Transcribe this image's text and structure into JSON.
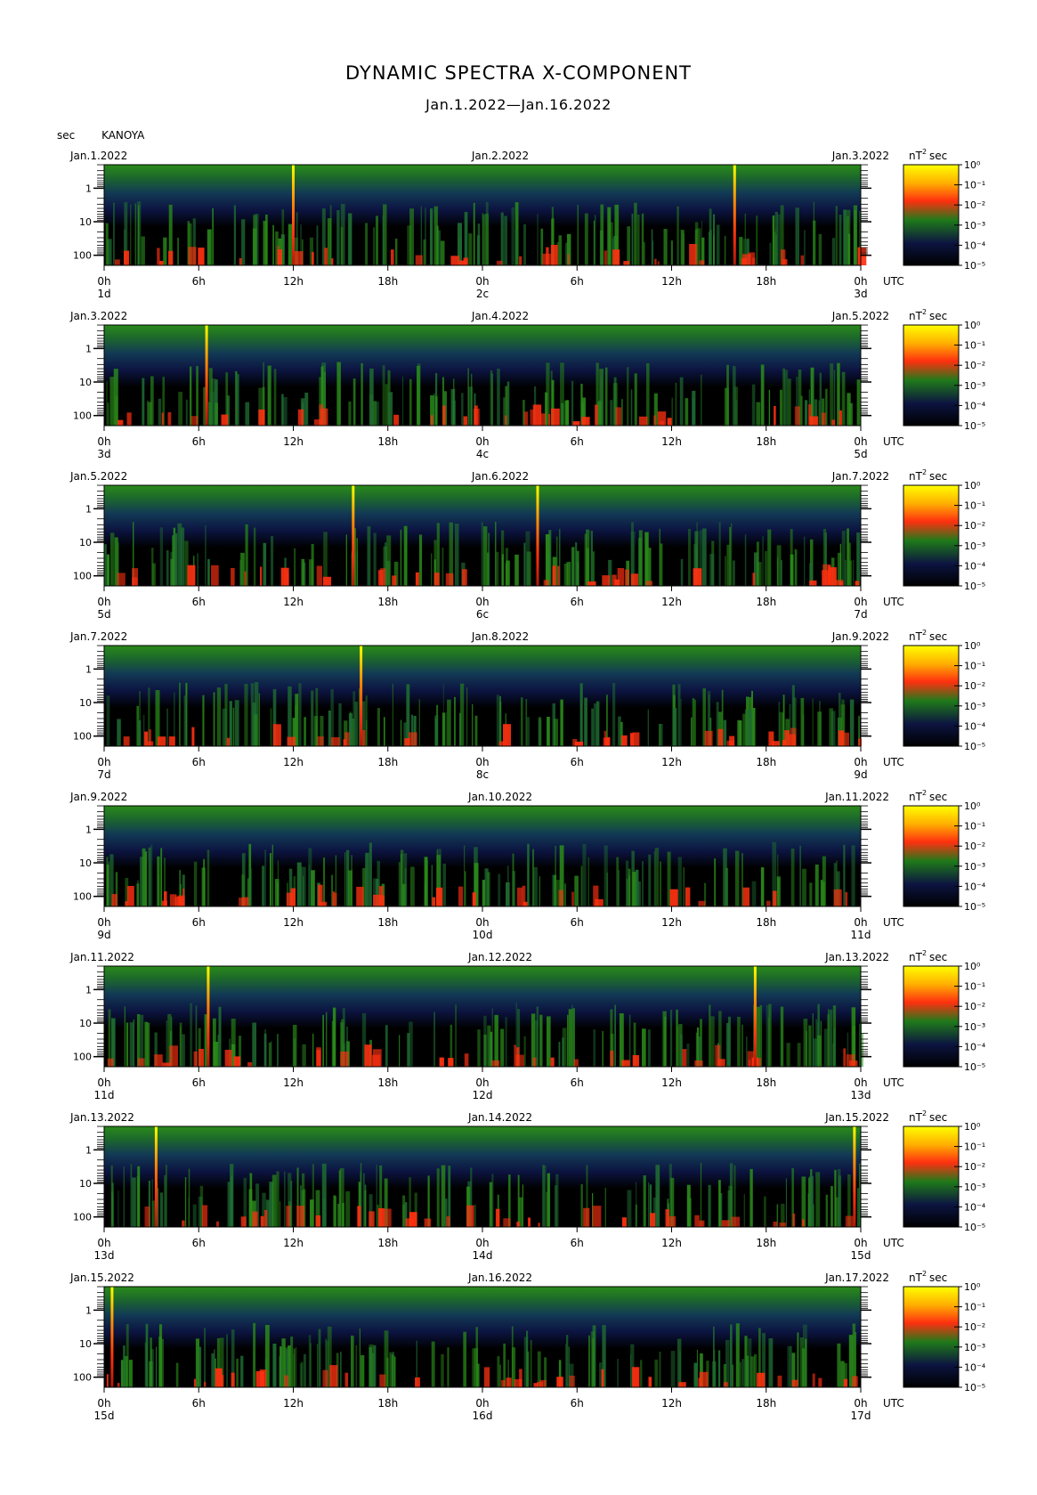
{
  "title": "DYNAMIC SPECTRA X-COMPONENT",
  "subtitle": "Jan.1.2022—Jan.16.2022",
  "station": "KANOYA",
  "yunit": "sec",
  "zunit_prefix": "nT",
  "zunit_exp": "2",
  "zunit_suffix": "sec",
  "utc_label": "UTC",
  "chart_data": {
    "type": "heatmap",
    "title": "DYNAMIC SPECTRA X-COMPONENT",
    "subtitle": "Jan.1.2022—Jan.16.2022",
    "ylabel": "sec",
    "y_scale": "log",
    "y_ticks": [
      "1",
      "10",
      "100"
    ],
    "x_ticks": [
      "0h",
      "6h",
      "12h",
      "18h",
      "0h",
      "6h",
      "12h",
      "18h",
      "0h"
    ],
    "colorbar_ticks": [
      "10⁰",
      "10⁻¹",
      "10⁻²",
      "10⁻³",
      "10⁻⁴",
      "10⁻⁵"
    ],
    "colorbar_unit": "nT² sec",
    "colors": {
      "high": "#ffff00",
      "mid_high": "#ff3010",
      "mid": "#2a8a1a",
      "low": "#0c1440",
      "floor": "#000000"
    },
    "panels": [
      {
        "date_left": "Jan.1.2022",
        "date_mid": "Jan.2.2022",
        "date_right": "Jan.3.2022",
        "day_left": "1d",
        "day_mid": "2c",
        "day_right": "3d",
        "spikes_hours": [
          12,
          40
        ]
      },
      {
        "date_left": "Jan.3.2022",
        "date_mid": "Jan.4.2022",
        "date_right": "Jan.5.2022",
        "day_left": "3d",
        "day_mid": "4c",
        "day_right": "5d",
        "spikes_hours": [
          6.5
        ]
      },
      {
        "date_left": "Jan.5.2022",
        "date_mid": "Jan.6.2022",
        "date_right": "Jan.7.2022",
        "day_left": "5d",
        "day_mid": "6c",
        "day_right": "7d",
        "spikes_hours": [
          15.8,
          27.5
        ]
      },
      {
        "date_left": "Jan.7.2022",
        "date_mid": "Jan.8.2022",
        "date_right": "Jan.9.2022",
        "day_left": "7d",
        "day_mid": "8c",
        "day_right": "9d",
        "spikes_hours": [
          16.3
        ]
      },
      {
        "date_left": "Jan.9.2022",
        "date_mid": "Jan.10.2022",
        "date_right": "Jan.11.2022",
        "day_left": "9d",
        "day_mid": "10d",
        "day_right": "11d",
        "spikes_hours": []
      },
      {
        "date_left": "Jan.11.2022",
        "date_mid": "Jan.12.2022",
        "date_right": "Jan.13.2022",
        "day_left": "11d",
        "day_mid": "12d",
        "day_right": "13d",
        "spikes_hours": [
          6.6,
          41.3
        ]
      },
      {
        "date_left": "Jan.13.2022",
        "date_mid": "Jan.14.2022",
        "date_right": "Jan.15.2022",
        "day_left": "13d",
        "day_mid": "14d",
        "day_right": "15d",
        "spikes_hours": [
          3.3,
          47.6
        ]
      },
      {
        "date_left": "Jan.15.2022",
        "date_mid": "Jan.16.2022",
        "date_right": "Jan.17.2022",
        "day_left": "15d",
        "day_mid": "16d",
        "day_right": "17d",
        "spikes_hours": [
          0.5
        ]
      }
    ]
  }
}
